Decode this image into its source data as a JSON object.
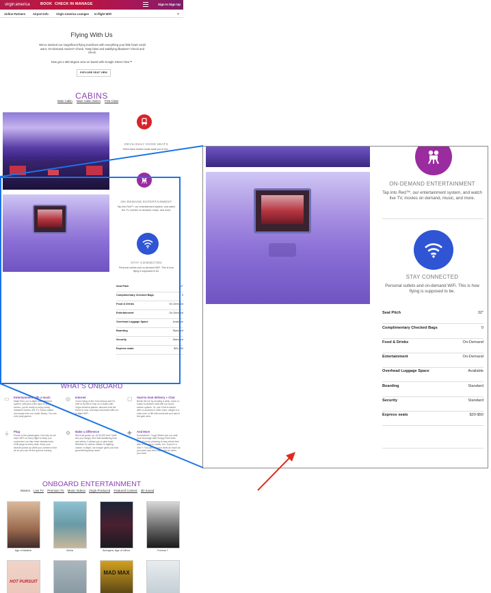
{
  "header": {
    "logo_script": "virgin",
    "logo_word": "america",
    "nav": [
      "BOOK",
      "CHECK IN",
      "MANAGE"
    ],
    "sign_in": "Sign In",
    "sign_up": "Sign Up"
  },
  "subnav": [
    "Airline Partners",
    "Airport Info",
    "Virgin America Lounges",
    "In-flight WiFi"
  ],
  "intro": {
    "title": "Flying With Us",
    "text": "We've stocked our magnificent flying machines with everything your little heart could want. On-demand movies? Check. Tasty bites and satisfying libations? Check and check.",
    "view_text": "Now get a 360-degree view on board with Google Street View™",
    "explore_button": "EXPLORE SEAT VIEW"
  },
  "cabins": {
    "title": "CABINS",
    "tabs": [
      "Main Cabin",
      "Main Cabin Select",
      "First Class"
    ]
  },
  "features": [
    {
      "icon": "seat-icon",
      "color": "#d8232a",
      "caption": "DEVILISHLY GOOD SEATS",
      "text": "Sleek black leather seats await you in the..."
    },
    {
      "icon": "projector-icon",
      "color": "#9b2ca0",
      "caption": "ON-DEMAND ENTERTAINMENT",
      "text": "Tap into Red™, our entertainment system, and watch live TV, movies on demand, music, and more."
    },
    {
      "icon": "wifi-icon",
      "color": "#2f55d4",
      "caption": "STAY CONNECTED",
      "text": "Personal outlets and on-demand WiFi. This is how flying is supposed to be."
    }
  ],
  "specs": [
    {
      "label": "Seat Pitch",
      "value": "32\""
    },
    {
      "label": "Complimentary Checked Bags",
      "value": "0"
    },
    {
      "label": "Food & Drinks",
      "value": "On-Demand"
    },
    {
      "label": "Entertainment",
      "value": "On-Demand"
    },
    {
      "label": "Overhead Luggage Space",
      "value": "Available"
    },
    {
      "label": "Boarding",
      "value": "Standard"
    },
    {
      "label": "Security",
      "value": "Standard"
    },
    {
      "label": "Express seats",
      "value": "$20-$50"
    }
  ],
  "whats_onboard": {
    "title": "WHAT'S ONBOARD",
    "items": [
      {
        "title": "Entertainment with a touch",
        "text": "Make Red, our in-flight entertainment system, with just a few taps on your screen, you're ready to enjoy newly released movies, live TV, music videos and songs from our music library. You can even play games."
      },
      {
        "title": "Internet",
        "text": "You're living in the 21st century and it's time to fly like it! Hop on a board with Virgin America planes; discover that the future is now, and stay connected with our in-flight WiFi."
      },
      {
        "title": "Seat-to-Seat delivery + Chat",
        "text": "Break the ice by sending a drink, meal, or snack to another seat with our touch screen system. Or, use Chat to banter with co-workers in other rows, mingle in a chat room or flirt with someone you saw in the gate area."
      },
      {
        "title": "Plug",
        "text": "Power to the passengers. Not only do we have WiFi on every flight to keep you connected, we also have standard and USB plugs at every seat. Keep your devices juiced up while you connect in the air so you can hit the ground running."
      },
      {
        "title": "Make a difference",
        "text": "We're all grown up. At 30,000 feet? Well. Are you hungry from that tantalizing food and drinks. It allows you to give back. Whether it's carbon offsets or fighting cancer, in-flight, our hunger gives you that good feeling deep down."
      },
      {
        "title": "And More",
        "text": "Somewhere? Yupp! Where are our seat your beverage with Hungry Fleet than. Also, if you're planning to stay whole time with or snacks or watch, too. If you're a Gen Y. You can use your drink as much as you want, and then make it to be when you want."
      }
    ]
  },
  "onboard_entertainment": {
    "title": "ONBOARD ENTERTAINMENT",
    "tabs": [
      "Movies",
      "Live TV",
      "Premium TV",
      "Music Videos",
      "Virgin Produced",
      "Featured Content",
      "3D Sound"
    ],
    "movies": [
      "Age of Adaline",
      "Aloha",
      "Avengers: Age of Ultron",
      "Furious 7"
    ],
    "second_row_titles": [
      "HOT PURSUIT",
      "",
      "MAD MAX",
      ""
    ]
  },
  "zoom": {
    "caption": "ON-DEMAND ENTERTAINMENT",
    "text": "Tap into Red™, our entertainment system, and watch live TV, movies on demand, music, and more.",
    "caption2": "STAY CONNECTED",
    "text2": "Personal outlets and on-demand WiFi. This is how flying is supposed to be."
  },
  "colors": {
    "brand_purple": "#8b3fb0",
    "highlight_blue": "#1a73e8",
    "arrow_red": "#e02a1b"
  }
}
